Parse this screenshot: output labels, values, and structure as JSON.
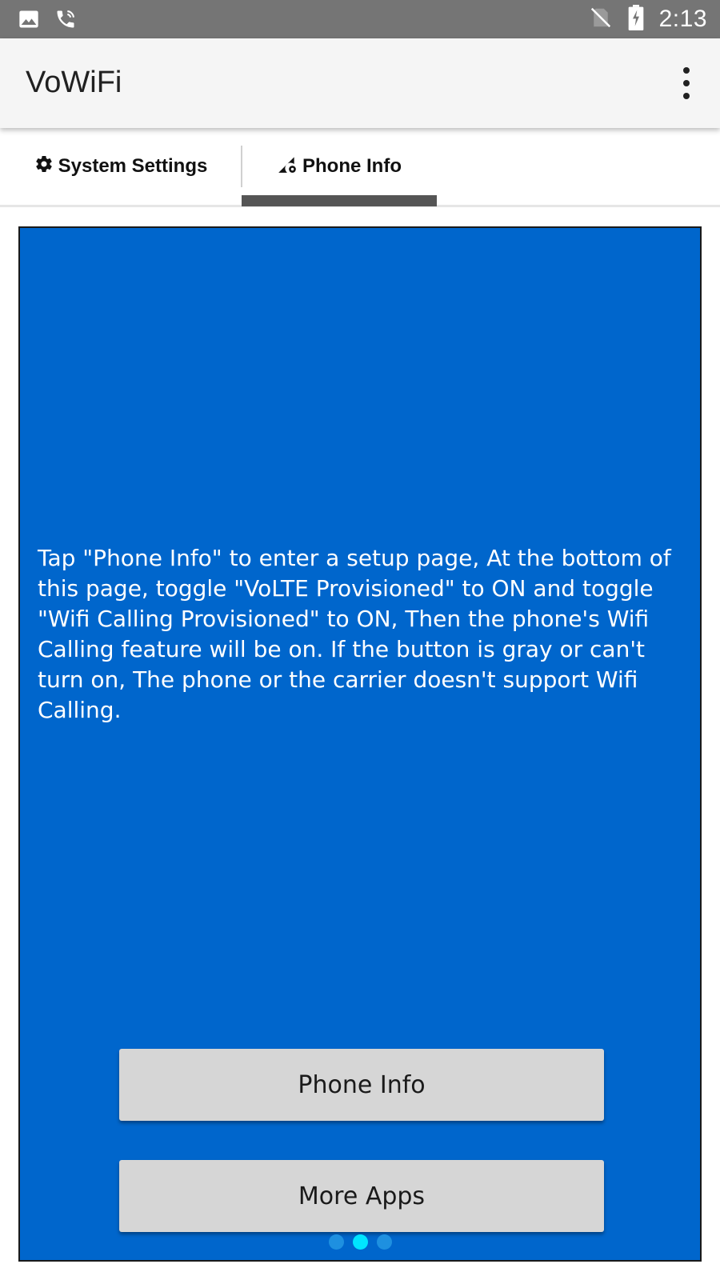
{
  "status_bar": {
    "time": "2:13",
    "left_icons": [
      "image-icon",
      "wifi-calling-icon"
    ],
    "right_icons": [
      "no-sim-icon",
      "battery-charging-icon"
    ]
  },
  "app_bar": {
    "title": "VoWiFi",
    "menu_icon": "more-vert-icon"
  },
  "tabs": [
    {
      "label": "System Settings",
      "icon": "gear-icon",
      "selected": false
    },
    {
      "label": "Phone Info",
      "icon": "signal-settings-icon",
      "selected": true
    }
  ],
  "main": {
    "background_color": "#0066cc",
    "instructions": "Tap \"Phone Info\" to enter a setup page, At the bottom of this page, toggle \"VoLTE Provisioned\" to ON and toggle \"Wifi Calling Provisioned\" to ON, Then the phone's Wifi Calling feature will be on. If the button is gray or can't turn on,  The phone or the carrier doesn't support Wifi Calling.",
    "phone_info_button": "Phone Info",
    "more_apps_button": "More Apps",
    "page_indicator": {
      "count": 3,
      "active_index": 1
    }
  }
}
